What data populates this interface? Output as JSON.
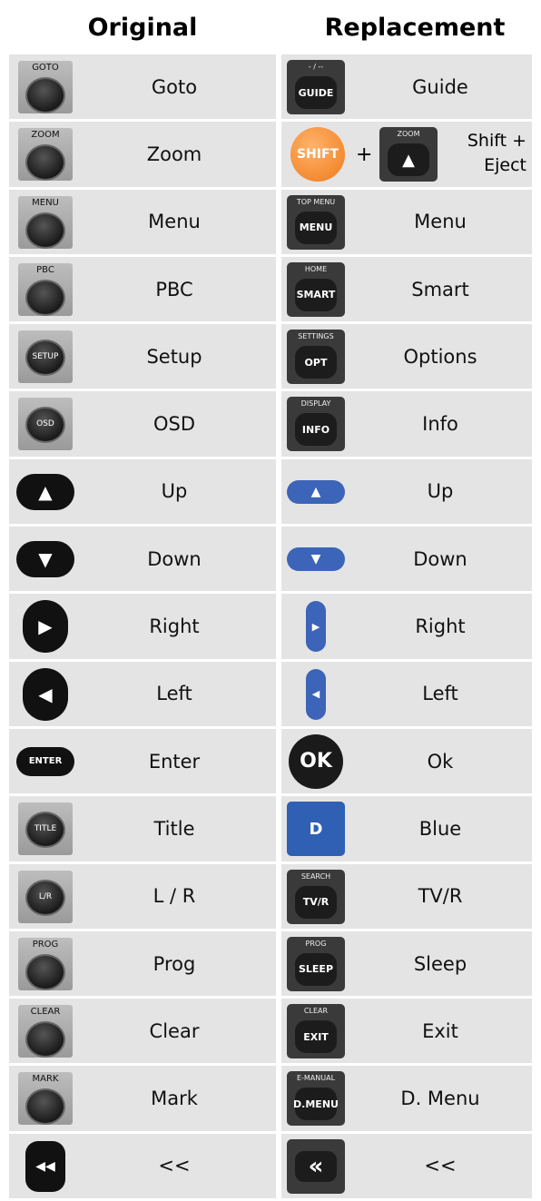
{
  "headers": {
    "original": "Original",
    "replacement": "Replacement"
  },
  "rows": [
    {
      "orig": "Goto",
      "orig_btn": "GOTO",
      "repl": "Guide",
      "repl_top": "- / --",
      "repl_btn": "GUIDE"
    },
    {
      "orig": "Zoom",
      "orig_btn": "ZOOM",
      "repl_line1": "Shift +",
      "repl_line2": "Eject",
      "shift_label": "SHIFT",
      "plus": "+",
      "zoom_top": "ZOOM",
      "eject_icon": "▲"
    },
    {
      "orig": "Menu",
      "orig_btn": "MENU",
      "repl": "Menu",
      "repl_top": "TOP MENU",
      "repl_btn": "MENU"
    },
    {
      "orig": "PBC",
      "orig_btn": "PBC",
      "repl": "Smart",
      "repl_top": "HOME",
      "repl_btn": "SMART"
    },
    {
      "orig": "Setup",
      "orig_btn": "SETUP",
      "repl": "Options",
      "repl_top": "SETTINGS",
      "repl_btn": "OPT"
    },
    {
      "orig": "OSD",
      "orig_btn": "OSD",
      "repl": "Info",
      "repl_top": "DISPLAY",
      "repl_btn": "INFO"
    },
    {
      "orig": "Up",
      "orig_icon": "▲",
      "repl": "Up",
      "repl_icon": "▲"
    },
    {
      "orig": "Down",
      "orig_icon": "▼",
      "repl": "Down",
      "repl_icon": "▼"
    },
    {
      "orig": "Right",
      "orig_icon": "▶",
      "repl": "Right",
      "repl_icon": "▶"
    },
    {
      "orig": "Left",
      "orig_icon": "◀",
      "repl": "Left",
      "repl_icon": "◀"
    },
    {
      "orig": "Enter",
      "orig_btn": "ENTER",
      "repl": "Ok",
      "repl_btn": "OK"
    },
    {
      "orig": "Title",
      "orig_btn": "TITLE",
      "repl": "Blue",
      "repl_btn": "D"
    },
    {
      "orig": "L / R",
      "orig_btn": "L/R",
      "repl": "TV/R",
      "repl_top": "SEARCH",
      "repl_btn": "TV/R"
    },
    {
      "orig": "Prog",
      "orig_btn": "PROG",
      "repl": "Sleep",
      "repl_top": "PROG",
      "repl_btn": "SLEEP"
    },
    {
      "orig": "Clear",
      "orig_btn": "CLEAR",
      "repl": "Exit",
      "repl_top": "CLEAR",
      "repl_btn": "EXIT"
    },
    {
      "orig": "Mark",
      "orig_btn": "MARK",
      "repl": "D. Menu",
      "repl_top": "E-MANUAL",
      "repl_btn": "D.MENU"
    },
    {
      "orig": "<<",
      "orig_icon": "◀◀",
      "repl": "<<",
      "repl_icon": "«"
    }
  ]
}
